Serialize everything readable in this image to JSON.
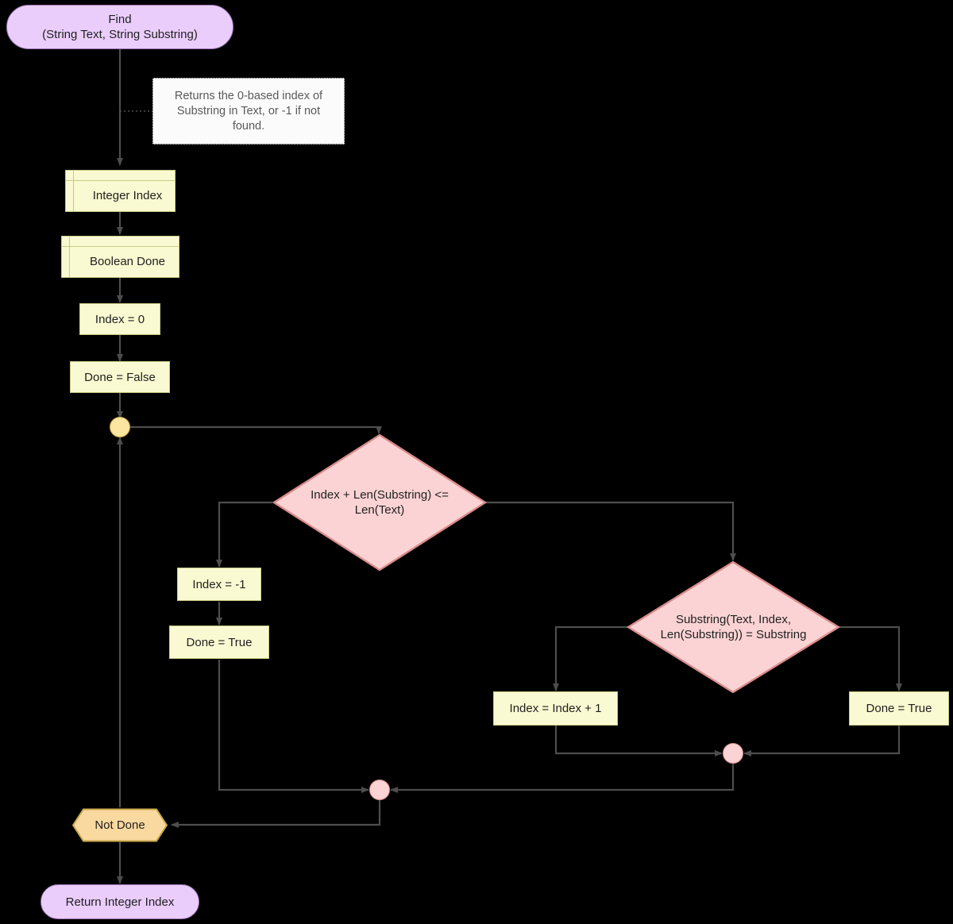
{
  "diagram": {
    "title": "Find (String Text, String Substring) flowchart",
    "colors": {
      "background": "#000000",
      "terminator_fill": "#EBCDFB",
      "terminator_stroke": "#9C77B8",
      "process_fill": "#FAFAD2",
      "process_stroke": "#C8C884",
      "decision_fill": "#FBD3D4",
      "decision_stroke": "#D98C8C",
      "loop_fill": "#FAD9A0",
      "loop_stroke": "#C8A84B",
      "merge_fill": "#FBD3D4",
      "merge_stroke": "#D98C8C",
      "edge_stroke": "#4d4d4d",
      "comment_fill": "#FBFBFB",
      "comment_text": "#5a5a5a",
      "node_text": "#1f1f1f"
    },
    "nodes": {
      "start": {
        "label": "Find\n(String Text, String Substring)",
        "line1": "Find",
        "line2": "(String Text, String Substring)",
        "shape": "terminator"
      },
      "comment": {
        "label": "Returns the 0-based index of Substring in Text, or -1 if not found.",
        "shape": "comment"
      },
      "decl_index": {
        "label": "Integer Index",
        "shape": "declaration"
      },
      "decl_done": {
        "label": "Boolean Done",
        "shape": "declaration"
      },
      "init_index": {
        "label": "Index = 0",
        "shape": "process"
      },
      "init_done": {
        "label": "Done = False",
        "shape": "process"
      },
      "loop_start": {
        "label": "",
        "shape": "loop-connector"
      },
      "cond_bounds": {
        "label": "Index + Len(Substring) <= Len(Text)",
        "line1": "Index + Len(Substring) <=",
        "line2": "Len(Text)",
        "shape": "decision"
      },
      "set_index_neg1": {
        "label": "Index = -1",
        "shape": "process"
      },
      "set_done_true_left": {
        "label": "Done = True",
        "shape": "process"
      },
      "cond_match": {
        "label": "Substring(Text, Index, Len(Substring)) = Substring",
        "line1": "Substring(Text, Index,",
        "line2": "Len(Substring)) = Substring",
        "shape": "decision"
      },
      "increment": {
        "label": "Index = Index + 1",
        "shape": "process"
      },
      "set_done_true_right": {
        "label": "Done = True",
        "shape": "process"
      },
      "merge_inner": {
        "label": "",
        "shape": "merge-connector"
      },
      "merge_outer": {
        "label": "",
        "shape": "merge-connector"
      },
      "loop_condition": {
        "label": "Not Done",
        "shape": "hexagon"
      },
      "end": {
        "label": "Return Integer Index",
        "shape": "terminator"
      }
    }
  }
}
